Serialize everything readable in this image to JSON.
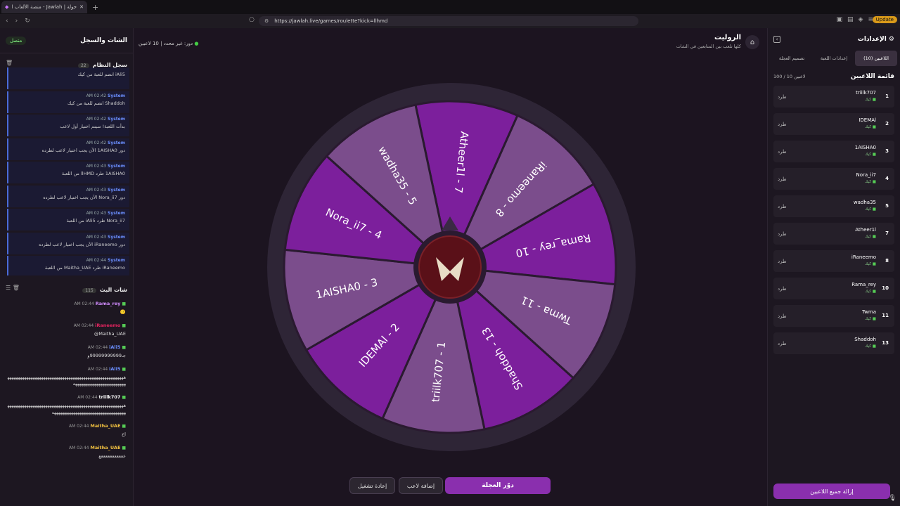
{
  "browser": {
    "tab_title": "جولة | Jawlah - منصة الألعاب التفا",
    "url": "https://jawlah.live/games/roulette?kick=llhmd",
    "update_label": "Update"
  },
  "left_panel": {
    "title": "الشات والسجل",
    "status": "متصل",
    "system_log": {
      "title": "سجل النظام",
      "count": "22",
      "entries": [
        {
          "time": "",
          "who": "",
          "text": "iAli5 انضم للعبة من كيك"
        },
        {
          "time": "AM 02:42",
          "who": "System",
          "text": "Shaddoh انضم للعبة من كيك"
        },
        {
          "time": "AM 02:42",
          "who": "System",
          "text": "بدأت اللعبة! سيتم اختيار أول لاعب"
        },
        {
          "time": "AM 02:42",
          "who": "System",
          "text": "دور 1AISHA0 الآن يجب اختيار لاعب لطرده"
        },
        {
          "time": "AM 02:43",
          "who": "System",
          "text": "1AISHA0 طرد llHMD من اللعبة"
        },
        {
          "time": "AM 02:43",
          "who": "System",
          "text": "دور Nora_ii7 الآن يجب اختيار لاعب لطرده"
        },
        {
          "time": "AM 02:43",
          "who": "System",
          "text": "Nora_ii7 طرد iAli5 من اللعبة"
        },
        {
          "time": "AM 02:43",
          "who": "System",
          "text": "دور iRaneemo الآن يجب اختيار لاعب لطرده"
        },
        {
          "time": "AM 02:44",
          "who": "System",
          "text": "iRaneemo طرد Maitha_UAE من اللعبة"
        }
      ]
    },
    "live_chat": {
      "title": "شات البث",
      "count": "115",
      "messages": [
        {
          "name": "Rama_rey",
          "color": "#d28cff",
          "time": "AM 02:44",
          "text": "🙂"
        },
        {
          "name": "iRaneemo",
          "color": "#e0245e",
          "time": "AM 02:44",
          "text": "@Maitha_UAE"
        },
        {
          "name": "iAli5",
          "color": "#6b8fff",
          "time": "AM 02:44",
          "text": "جـ99999999999و"
        },
        {
          "name": "iAli5",
          "color": "#6b8fff",
          "time": "AM 02:44",
          "text": "ههههههههههههههههههههههههههههههههههههههههههههههههههههههههههههههههههههههههههههههههه"
        },
        {
          "name": "triilk707",
          "color": "#ffffff",
          "time": "AM 02:44",
          "text": "ههههههههههههههههههههههههههههههههههههههههههههههههههههههههههههههههههههههههههههههههههههههههههه"
        },
        {
          "name": "Maitha_UAE",
          "color": "#f0c040",
          "time": "AM 02:44",
          "text": "اخ"
        },
        {
          "name": "Maitha_UAE",
          "color": "#f0c040",
          "time": "AM 02:44",
          "text": "عععععععععععع"
        }
      ]
    }
  },
  "game": {
    "players_count": "10 لاعبين",
    "turn": "دور: غير محدد",
    "title": "الروليت",
    "subtitle": "كلها تلعب بين المتابعين في الشات",
    "wheel_labels": [
      "Atheer1l - 7",
      "iRaneemo - 8",
      "Rama_rey - 10",
      "Twma - 11",
      "Shaddoh - 13",
      "triilk707 - 1",
      "IDEMAl - 2",
      "1AISHA0 - 3",
      "Nora_ii7 - 4",
      "wadha35 - 5"
    ],
    "buttons": {
      "restart": "إعادة تشغيل",
      "add_player": "إضافة لاعب",
      "spin": "دوّر العجلة"
    }
  },
  "right_panel": {
    "title": "الإعدادات",
    "tabs": [
      "اللاعبين (10)",
      "إعدادات اللعبة",
      "تصميم العجلة"
    ],
    "list_title": "قائمة اللاعبين",
    "list_count": "100 / 10 لاعبين",
    "kick_label": "طرد",
    "source_label": "كيك",
    "players": [
      {
        "no": "1",
        "name": "triilk707"
      },
      {
        "no": "2",
        "name": "IDEMAl"
      },
      {
        "no": "3",
        "name": "1AISHA0"
      },
      {
        "no": "4",
        "name": "Nora_ii7"
      },
      {
        "no": "5",
        "name": "wadha35"
      },
      {
        "no": "7",
        "name": "Atheer1l"
      },
      {
        "no": "8",
        "name": "iRaneemo"
      },
      {
        "no": "10",
        "name": "Rama_rey"
      },
      {
        "no": "11",
        "name": "Twma"
      },
      {
        "no": "13",
        "name": "Shaddoh"
      }
    ],
    "remove_all": "إزالة جميع اللاعبين"
  },
  "colors": {
    "dark_slice": "#7c1f9c",
    "light_slice": "#7b4d8c",
    "accent": "#8a2fae"
  }
}
